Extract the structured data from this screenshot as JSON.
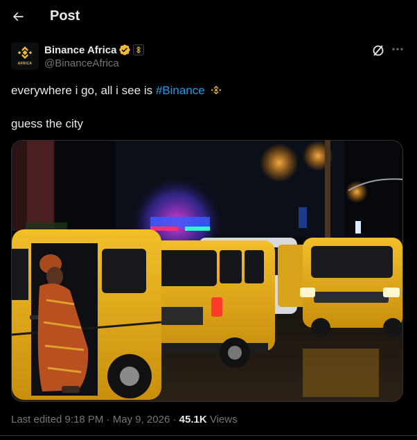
{
  "header": {
    "title": "Post",
    "back_icon": "arrow-left-icon"
  },
  "author": {
    "display_name": "Binance Africa",
    "handle": "@BinanceAfrica",
    "avatar_caption": "AFRICA",
    "verified_color": "#f3ba2f",
    "brand_color": "#f3ba2f"
  },
  "tweet": {
    "text_before": "everywhere i go, all i see is ",
    "hashtag": "#Binance",
    "line2": "guess the city"
  },
  "meta": {
    "edited": "Last edited 9:18 PM · May 9, 2026 · ",
    "views_count": "45.1K",
    "views_label": " Views"
  },
  "colors": {
    "accent": "#1d9bf0",
    "muted": "#71767b",
    "text": "#e7e9ea",
    "background": "#000000"
  }
}
